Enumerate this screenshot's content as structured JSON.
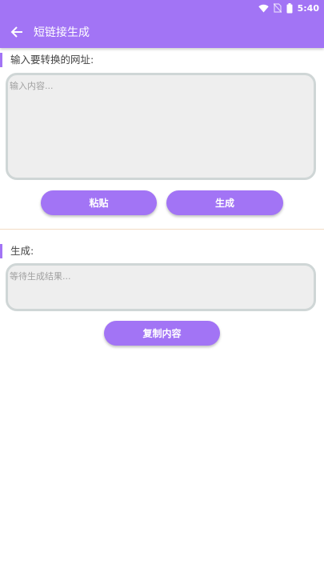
{
  "status_bar": {
    "time": "5:40",
    "icons": [
      "wifi-icon",
      "no-sim-icon",
      "battery-icon"
    ]
  },
  "app_bar": {
    "title": "短链接生成",
    "back_icon": "arrow-back-icon"
  },
  "input_section": {
    "label": "输入要转换的网址:",
    "placeholder": "输入内容...",
    "value": ""
  },
  "actions": {
    "paste_label": "粘贴",
    "generate_label": "生成"
  },
  "output_section": {
    "label": "生成:",
    "placeholder": "等待生成结果..."
  },
  "copy_button": {
    "label": "复制内容"
  },
  "colors": {
    "accent": "#a274f5",
    "field_bg": "#eeeeee",
    "field_border": "#cfd6d6"
  }
}
